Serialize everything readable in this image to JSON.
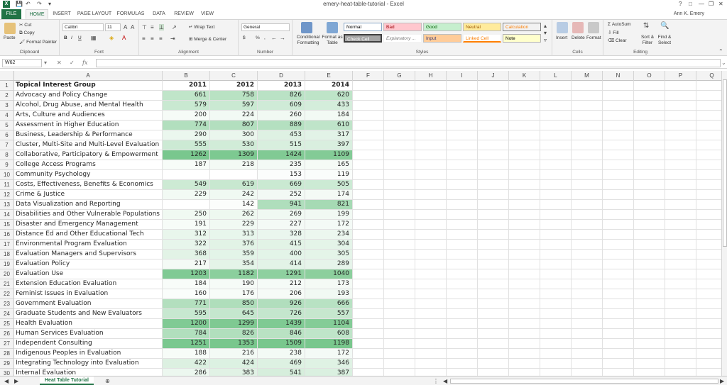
{
  "window": {
    "title": "emery-heat-table-tutorial - Excel",
    "user": "Ann K. Emery",
    "help": "?",
    "minimize": "—",
    "restore": "❐",
    "close": "✕"
  },
  "tabs": [
    "FILE",
    "HOME",
    "INSERT",
    "PAGE LAYOUT",
    "FORMULAS",
    "DATA",
    "REVIEW",
    "VIEW"
  ],
  "ribbon": {
    "clipboard": {
      "paste": "Paste",
      "cut": "Cut",
      "copy": "Copy",
      "format_painter": "Format Painter",
      "label": "Clipboard"
    },
    "font": {
      "name": "Calibri",
      "size": "11",
      "label": "Font",
      "bold": "B",
      "italic": "I",
      "underline": "U"
    },
    "alignment": {
      "wrap": "Wrap Text",
      "merge": "Merge & Center",
      "label": "Alignment"
    },
    "number": {
      "format": "General",
      "label": "Number",
      "currency": "$",
      "percent": "%",
      "comma": ","
    },
    "styles": {
      "conditional": "Conditional Formatting",
      "format_table": "Format as Table",
      "cells": [
        "Normal",
        "Bad",
        "Good",
        "Neutral",
        "Calculation",
        "Check Cell",
        "Explanatory ...",
        "Input",
        "Linked Cell",
        "Note"
      ],
      "label": "Styles"
    },
    "cells": {
      "insert": "Insert",
      "delete": "Delete",
      "format": "Format",
      "label": "Cells"
    },
    "editing": {
      "autosum": "AutoSum",
      "fill": "Fill",
      "clear": "Clear",
      "sort": "Sort & Filter",
      "find": "Find & Select",
      "label": "Editing"
    }
  },
  "formula_bar": {
    "name_box": "W62",
    "fx": "fx",
    "value": ""
  },
  "columns": [
    "A",
    "B",
    "C",
    "D",
    "E",
    "F",
    "G",
    "H",
    "I",
    "J",
    "K",
    "L",
    "M",
    "N",
    "O",
    "P",
    "Q"
  ],
  "header_row": {
    "group": "Topical Interest Group",
    "years": [
      "2011",
      "2012",
      "2013",
      "2014"
    ]
  },
  "rows": [
    {
      "n": "2",
      "name": "Advocacy and Policy Change",
      "v": [
        "661",
        "758",
        "826",
        "620"
      ]
    },
    {
      "n": "3",
      "name": "Alcohol, Drug Abuse, and Mental Health",
      "v": [
        "579",
        "597",
        "609",
        "433"
      ]
    },
    {
      "n": "4",
      "name": "Arts, Culture and Audiences",
      "v": [
        "200",
        "224",
        "260",
        "184"
      ]
    },
    {
      "n": "5",
      "name": "Assessment in Higher Education",
      "v": [
        "774",
        "807",
        "889",
        "610"
      ]
    },
    {
      "n": "6",
      "name": "Business, Leadership & Performance",
      "v": [
        "290",
        "300",
        "453",
        "317"
      ]
    },
    {
      "n": "7",
      "name": "Cluster, Multi-Site and Multi-Level Evaluation",
      "v": [
        "555",
        "530",
        "515",
        "397"
      ]
    },
    {
      "n": "8",
      "name": "Collaborative, Participatory & Empowerment",
      "v": [
        "1262",
        "1309",
        "1424",
        "1109"
      ]
    },
    {
      "n": "9",
      "name": "College Access Programs",
      "v": [
        "187",
        "218",
        "235",
        "165"
      ]
    },
    {
      "n": "10",
      "name": "Community Psychology",
      "v": [
        "",
        "",
        "153",
        "119"
      ]
    },
    {
      "n": "11",
      "name": "Costs, Effectiveness, Benefits & Economics",
      "v": [
        "549",
        "619",
        "669",
        "505"
      ]
    },
    {
      "n": "12",
      "name": "Crime & Justice",
      "v": [
        "229",
        "242",
        "252",
        "174"
      ]
    },
    {
      "n": "13",
      "name": "Data Visualization and Reporting",
      "v": [
        "",
        "142",
        "941",
        "821"
      ]
    },
    {
      "n": "14",
      "name": "Disabilities and Other Vulnerable Populations",
      "v": [
        "250",
        "262",
        "269",
        "199"
      ]
    },
    {
      "n": "15",
      "name": "Disaster and Emergency Management",
      "v": [
        "191",
        "229",
        "227",
        "172"
      ]
    },
    {
      "n": "16",
      "name": "Distance Ed and Other Educational Tech",
      "v": [
        "312",
        "313",
        "328",
        "234"
      ]
    },
    {
      "n": "17",
      "name": "Environmental Program Evaluation",
      "v": [
        "322",
        "376",
        "415",
        "304"
      ]
    },
    {
      "n": "18",
      "name": "Evaluation Managers and Supervisors",
      "v": [
        "368",
        "359",
        "400",
        "305"
      ]
    },
    {
      "n": "19",
      "name": "Evaluation Policy",
      "v": [
        "217",
        "354",
        "414",
        "289"
      ]
    },
    {
      "n": "20",
      "name": "Evaluation Use",
      "v": [
        "1203",
        "1182",
        "1291",
        "1040"
      ]
    },
    {
      "n": "21",
      "name": "Extension Education Evaluation",
      "v": [
        "184",
        "190",
        "212",
        "173"
      ]
    },
    {
      "n": "22",
      "name": "Feminist Issues in Evaluation",
      "v": [
        "160",
        "176",
        "206",
        "193"
      ]
    },
    {
      "n": "23",
      "name": "Government Evaluation",
      "v": [
        "771",
        "850",
        "926",
        "666"
      ]
    },
    {
      "n": "24",
      "name": "Graduate Students and New Evaluators",
      "v": [
        "595",
        "645",
        "726",
        "557"
      ]
    },
    {
      "n": "25",
      "name": "Health Evaluation",
      "v": [
        "1200",
        "1299",
        "1439",
        "1104"
      ]
    },
    {
      "n": "26",
      "name": "Human Services Evaluation",
      "v": [
        "784",
        "826",
        "846",
        "608"
      ]
    },
    {
      "n": "27",
      "name": "Independent Consulting",
      "v": [
        "1251",
        "1353",
        "1509",
        "1198"
      ]
    },
    {
      "n": "28",
      "name": "Indigenous Peoples in Evaluation",
      "v": [
        "188",
        "216",
        "238",
        "172"
      ]
    },
    {
      "n": "29",
      "name": "Integrating Technology into Evaluation",
      "v": [
        "422",
        "424",
        "469",
        "346"
      ]
    },
    {
      "n": "30",
      "name": "Internal Evaluation",
      "v": [
        "286",
        "383",
        "541",
        "387"
      ]
    }
  ],
  "sheet_tab": "Heat Table Tutorial",
  "add_sheet": "⊕",
  "heat_colors": {
    "low": "#ffffff",
    "high": "#63be7b"
  }
}
